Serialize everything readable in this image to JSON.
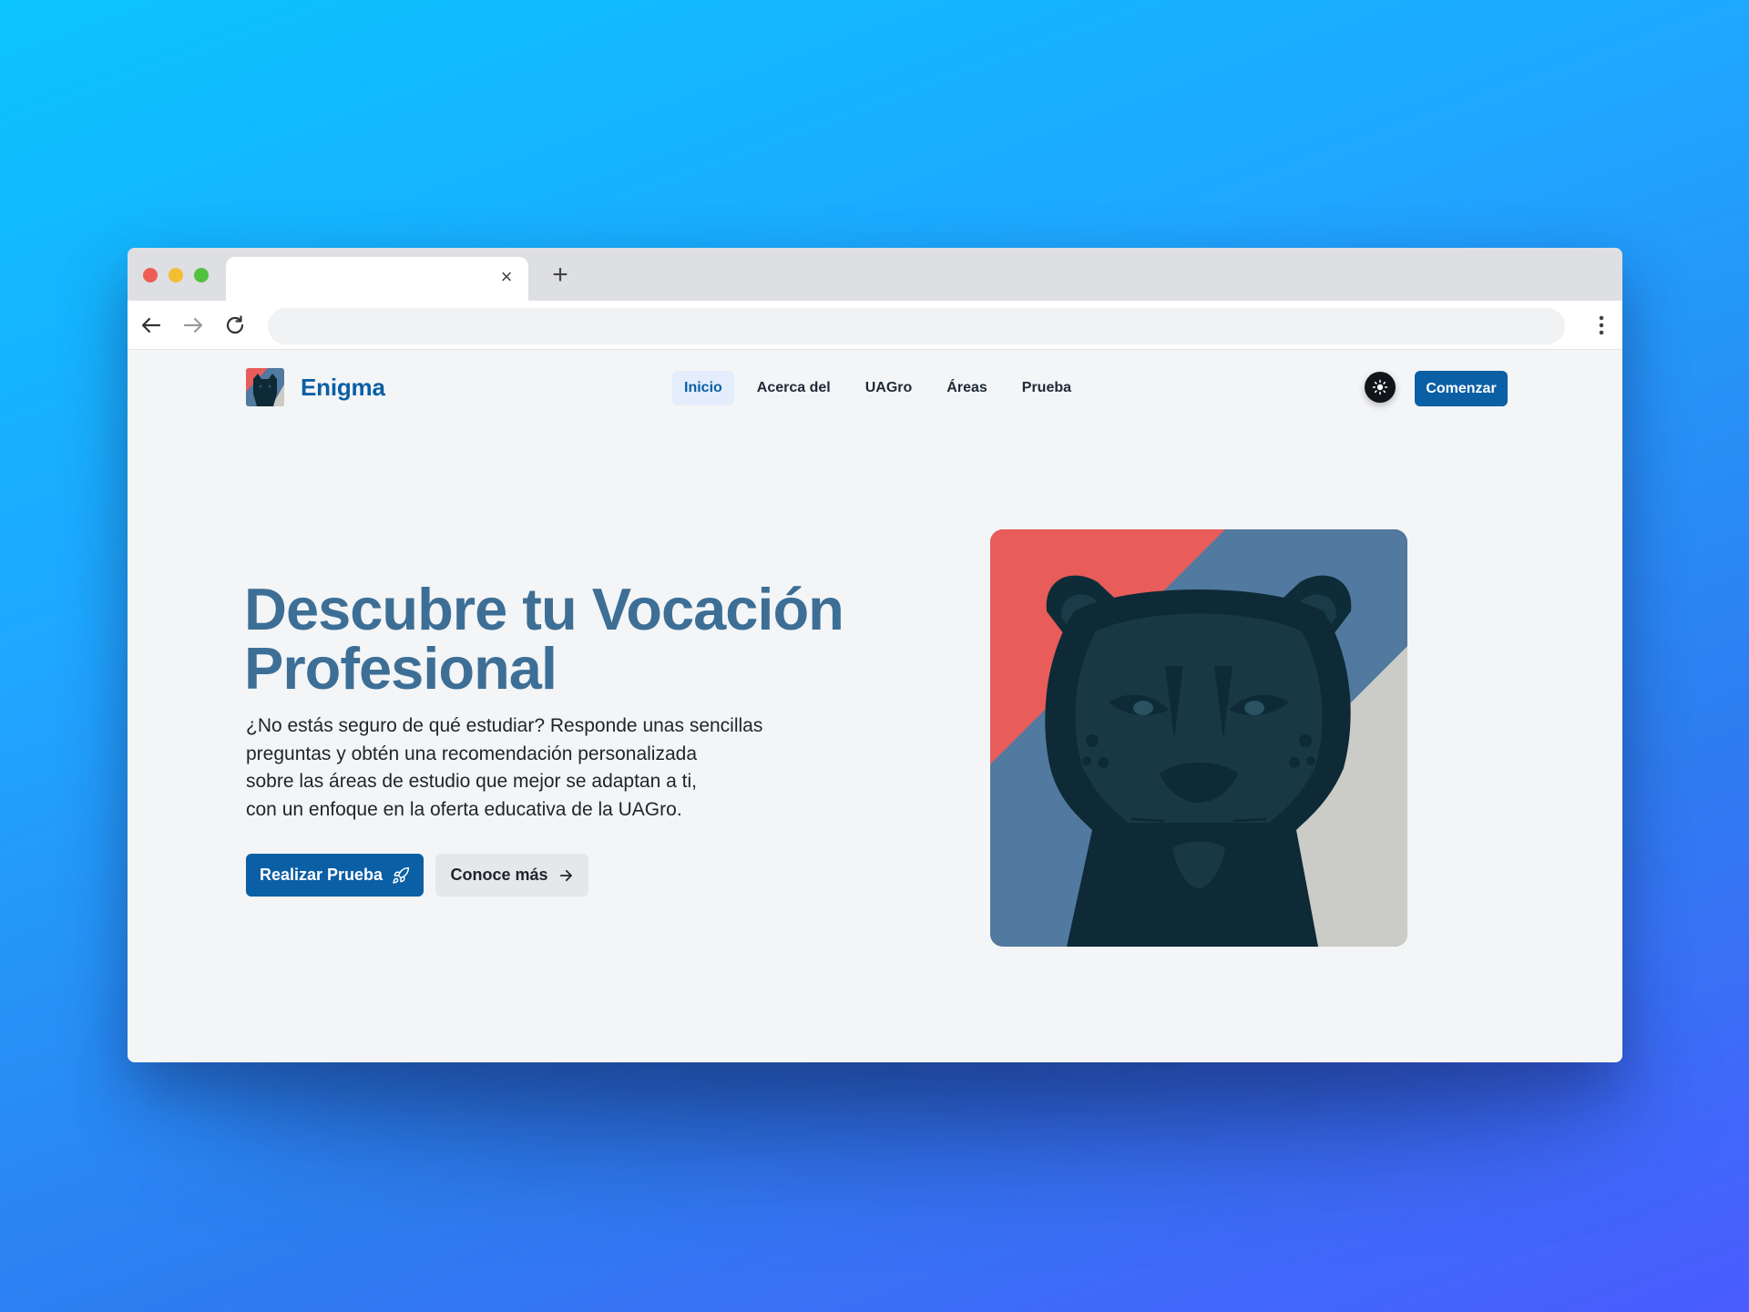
{
  "browser": {
    "tab_close": "×",
    "new_tab": "+",
    "url": ""
  },
  "brand": {
    "name": "Enigma",
    "logo_icon": "panther-logo"
  },
  "nav": {
    "items": [
      {
        "label": "Inicio",
        "active": true
      },
      {
        "label": "Acerca del",
        "active": false
      },
      {
        "label": "UAGro",
        "active": false
      },
      {
        "label": "Áreas",
        "active": false
      },
      {
        "label": "Prueba",
        "active": false
      }
    ],
    "theme_icon": "sun-icon",
    "cta_label": "Comenzar"
  },
  "hero": {
    "title_line1": "Descubre tu Vocación",
    "title_line2": "Profesional",
    "description_lines": [
      "¿No estás seguro de qué estudiar? Responde unas sencillas",
      "preguntas y obtén una recomendación personalizada",
      "sobre las áreas de estudio que mejor se adaptan a ti,",
      "con un enfoque en la oferta educativa de la UAGro."
    ],
    "primary_button": "Realizar Prueba",
    "primary_icon": "rocket-icon",
    "secondary_button": "Conoce más",
    "secondary_icon": "arrow-right-icon",
    "image_icon": "panther-illustration"
  },
  "colors": {
    "brand_blue": "#0b5fa5",
    "title_blue": "#3d6f96",
    "panther_red": "#e85c5a",
    "panther_steel": "#52799f",
    "panther_gray": "#cbcbc7",
    "panther_dark": "#0d2a36"
  }
}
